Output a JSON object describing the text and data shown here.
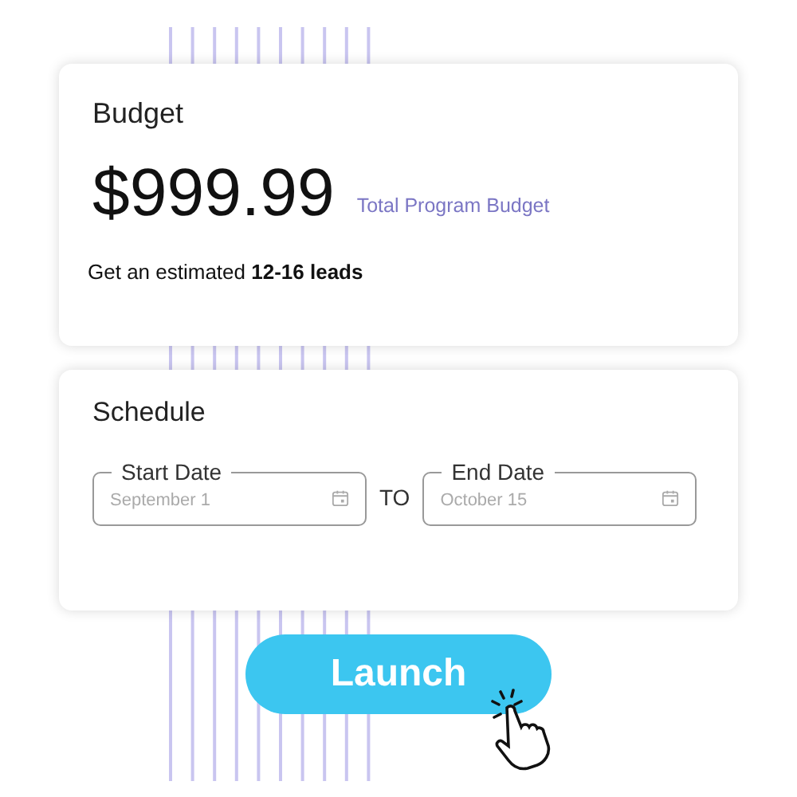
{
  "budget": {
    "title": "Budget",
    "amount": "$999.99",
    "amount_label": "Total Program Budget",
    "estimate": "Get an estimated **12-16 leads**"
  },
  "schedule": {
    "title": "Schedule",
    "fields": [
      {
        "label": "Start Date",
        "placeholder": "September 1"
      },
      {
        "label": "End Date",
        "placeholder": "October 15"
      }
    ],
    "separator": "TO"
  },
  "launch_button": "Launch"
}
